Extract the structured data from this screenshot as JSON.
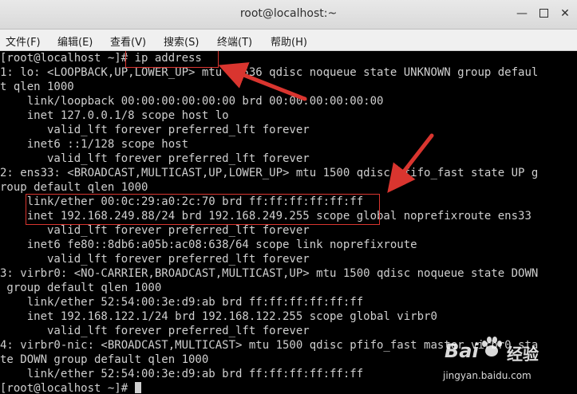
{
  "window": {
    "title": "root@localhost:~",
    "minimize_glyph": "—",
    "close_glyph": "✕"
  },
  "menubar": {
    "items": [
      {
        "label": "文件(F)"
      },
      {
        "label": "编辑(E)"
      },
      {
        "label": "查看(V)"
      },
      {
        "label": "搜索(S)"
      },
      {
        "label": "终端(T)"
      },
      {
        "label": "帮助(H)"
      }
    ]
  },
  "terminal": {
    "lines": [
      "[root@localhost ~]# ip address",
      "1: lo: <LOOPBACK,UP,LOWER_UP> mtu 65536 qdisc noqueue state UNKNOWN group defaul",
      "t qlen 1000",
      "    link/loopback 00:00:00:00:00:00 brd 00:00:00:00:00:00",
      "    inet 127.0.0.1/8 scope host lo",
      "       valid_lft forever preferred_lft forever",
      "    inet6 ::1/128 scope host",
      "       valid_lft forever preferred_lft forever",
      "2: ens33: <BROADCAST,MULTICAST,UP,LOWER_UP> mtu 1500 qdisc pfifo_fast state UP g",
      "roup default qlen 1000",
      "    link/ether 00:0c:29:a0:2c:70 brd ff:ff:ff:ff:ff:ff",
      "    inet 192.168.249.88/24 brd 192.168.249.255 scope global noprefixroute ens33",
      "       valid_lft forever preferred_lft forever",
      "    inet6 fe80::8db6:a05b:ac08:638/64 scope link noprefixroute",
      "       valid_lft forever preferred_lft forever",
      "3: virbr0: <NO-CARRIER,BROADCAST,MULTICAST,UP> mtu 1500 qdisc noqueue state DOWN",
      " group default qlen 1000",
      "    link/ether 52:54:00:3e:d9:ab brd ff:ff:ff:ff:ff:ff",
      "    inet 192.168.122.1/24 brd 192.168.122.255 scope global virbr0",
      "       valid_lft forever preferred_lft forever",
      "4: virbr0-nic: <BROADCAST,MULTICAST> mtu 1500 qdisc pfifo_fast master virbr0 sta",
      "te DOWN group default qlen 1000",
      "    link/ether 52:54:00:3e:d9:ab brd ff:ff:ff:ff:ff:ff"
    ],
    "prompt": "[root@localhost ~]# "
  },
  "watermark": {
    "brand_left": "Bai",
    "brand_right": "经验",
    "site": "jingyan.baidu.com"
  },
  "colors": {
    "annotation_red": "#d9352f",
    "terminal_bg": "#000000",
    "terminal_fg": "#cfcfcf"
  }
}
